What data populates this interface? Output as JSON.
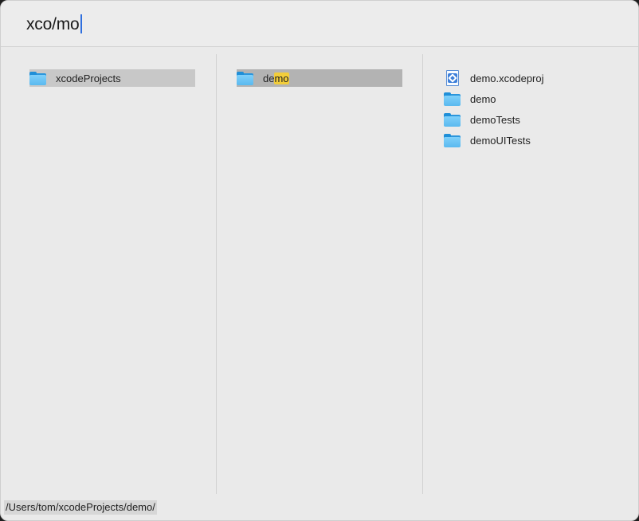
{
  "search": {
    "query": "xco/mo"
  },
  "columns": [
    {
      "items": [
        {
          "label": "xcodeProjects",
          "icon": "folder-icon"
        }
      ]
    },
    {
      "items": [
        {
          "label_before": "de",
          "label_match": "mo",
          "icon": "folder-icon"
        }
      ]
    },
    {
      "items": [
        {
          "label": "demo.xcodeproj",
          "icon": "xcodeproj-file-icon"
        },
        {
          "label": "demo",
          "icon": "folder-icon"
        },
        {
          "label": "demoTests",
          "icon": "folder-icon"
        },
        {
          "label": "demoUITests",
          "icon": "folder-icon"
        }
      ]
    }
  ],
  "status": {
    "path": "/Users/tom/xcodeProjects/demo/"
  },
  "colors": {
    "background": "#eaeaea",
    "selection": "#c8c8c8",
    "selection_active": "#b3b3b3",
    "match_highlight": "#f2cd3a",
    "caret": "#2f6fde",
    "folder": "#5ab9ef"
  }
}
